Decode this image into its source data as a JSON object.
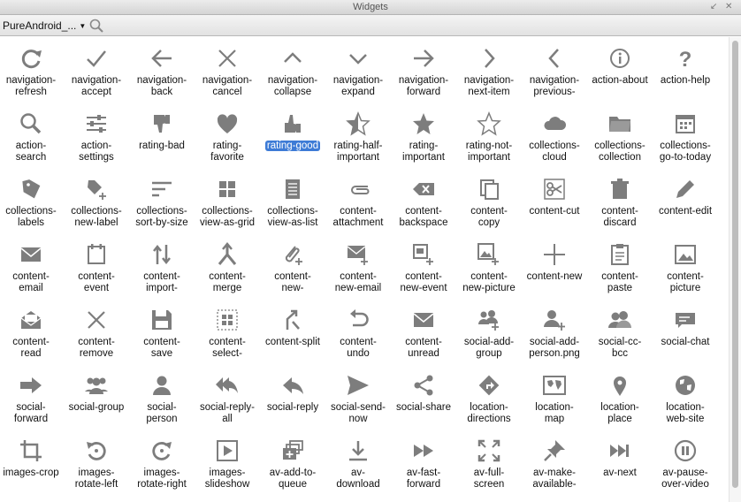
{
  "window": {
    "title": "Widgets"
  },
  "toolbar": {
    "source": "PureAndroid_..."
  },
  "colors": {
    "icon": "#7d7d7d",
    "selection": "#3d7bd6"
  },
  "selected": "rating-good",
  "icons": [
    {
      "id": "navigation-refresh",
      "label": "navigation-\nrefresh",
      "icon": "refresh"
    },
    {
      "id": "navigation-accept",
      "label": "navigation-\naccept",
      "icon": "check"
    },
    {
      "id": "navigation-back",
      "label": "navigation-\nback",
      "icon": "arrow-left"
    },
    {
      "id": "navigation-cancel",
      "label": "navigation-\ncancel",
      "icon": "x"
    },
    {
      "id": "navigation-collapse",
      "label": "navigation-\ncollapse",
      "icon": "chevron-up"
    },
    {
      "id": "navigation-expand",
      "label": "navigation-\nexpand",
      "icon": "chevron-down"
    },
    {
      "id": "navigation-forward",
      "label": "navigation-\nforward",
      "icon": "arrow-right"
    },
    {
      "id": "navigation-next-item",
      "label": "navigation-\nnext-item",
      "icon": "chevron-right"
    },
    {
      "id": "navigation-previous",
      "label": "navigation-\nprevious-",
      "icon": "chevron-left"
    },
    {
      "id": "action-about",
      "label": "action-about",
      "icon": "info"
    },
    {
      "id": "action-help",
      "label": "action-help",
      "icon": "question"
    },
    {
      "id": "action-search",
      "label": "action-\nsearch",
      "icon": "search"
    },
    {
      "id": "action-settings",
      "label": "action-\nsettings",
      "icon": "sliders"
    },
    {
      "id": "rating-bad",
      "label": "rating-bad",
      "icon": "thumbs-down"
    },
    {
      "id": "rating-favorite",
      "label": "rating-\nfavorite",
      "icon": "heart"
    },
    {
      "id": "rating-good",
      "label": "rating-good",
      "icon": "thumbs-up"
    },
    {
      "id": "rating-half-important",
      "label": "rating-half-\nimportant",
      "icon": "star-half"
    },
    {
      "id": "rating-important",
      "label": "rating-\nimportant",
      "icon": "star"
    },
    {
      "id": "rating-not-important",
      "label": "rating-not-\nimportant",
      "icon": "star-outline"
    },
    {
      "id": "collections-cloud",
      "label": "collections-\ncloud",
      "icon": "cloud"
    },
    {
      "id": "collections-collection",
      "label": "collections-\ncollection",
      "icon": "folder"
    },
    {
      "id": "collections-go-to-today",
      "label": "collections-\ngo-to-today",
      "icon": "calendar"
    },
    {
      "id": "collections-labels",
      "label": "collections-\nlabels",
      "icon": "label"
    },
    {
      "id": "collections-new-label",
      "label": "collections-\nnew-label",
      "icon": "label-plus"
    },
    {
      "id": "collections-sort-by-size",
      "label": "collections-\nsort-by-size",
      "icon": "sort"
    },
    {
      "id": "collections-view-as-grid",
      "label": "collections-\nview-as-grid",
      "icon": "grid"
    },
    {
      "id": "collections-view-as-list",
      "label": "collections-\nview-as-list",
      "icon": "list"
    },
    {
      "id": "content-attachment",
      "label": "content-\nattachment",
      "icon": "paperclip"
    },
    {
      "id": "content-backspace",
      "label": "content-\nbackspace",
      "icon": "backspace"
    },
    {
      "id": "content-copy",
      "label": "content-\ncopy",
      "icon": "copy"
    },
    {
      "id": "content-cut",
      "label": "content-cut",
      "icon": "scissors"
    },
    {
      "id": "content-discard",
      "label": "content-\ndiscard",
      "icon": "trash"
    },
    {
      "id": "content-edit",
      "label": "content-edit",
      "icon": "pencil"
    },
    {
      "id": "content-email",
      "label": "content-\nemail",
      "icon": "envelope"
    },
    {
      "id": "content-event",
      "label": "content-\nevent",
      "icon": "event"
    },
    {
      "id": "content-import",
      "label": "content-\nimport-",
      "icon": "import"
    },
    {
      "id": "content-merge",
      "label": "content-\nmerge",
      "icon": "merge"
    },
    {
      "id": "content-new",
      "label": "content-\nnew-",
      "icon": "paperclip-plus"
    },
    {
      "id": "content-new-email",
      "label": "content-\nnew-email",
      "icon": "envelope-plus"
    },
    {
      "id": "content-new-event",
      "label": "content-\nnew-event",
      "icon": "event-plus"
    },
    {
      "id": "content-new-picture",
      "label": "content-\nnew-picture",
      "icon": "picture-plus"
    },
    {
      "id": "content-new-plain",
      "label": "content-new",
      "icon": "plus"
    },
    {
      "id": "content-paste",
      "label": "content-\npaste",
      "icon": "clipboard"
    },
    {
      "id": "content-picture",
      "label": "content-\npicture",
      "icon": "picture"
    },
    {
      "id": "content-read",
      "label": "content-\nread",
      "icon": "envelope-open"
    },
    {
      "id": "content-remove",
      "label": "content-\nremove",
      "icon": "x"
    },
    {
      "id": "content-save",
      "label": "content-\nsave",
      "icon": "save"
    },
    {
      "id": "content-select",
      "label": "content-\nselect-",
      "icon": "select"
    },
    {
      "id": "content-split",
      "label": "content-split",
      "icon": "split"
    },
    {
      "id": "content-undo",
      "label": "content-\nundo",
      "icon": "undo"
    },
    {
      "id": "content-unread",
      "label": "content-\nunread",
      "icon": "envelope"
    },
    {
      "id": "social-add-group",
      "label": "social-add-\ngroup",
      "icon": "group-plus"
    },
    {
      "id": "social-add-person",
      "label": "social-add-\nperson.png",
      "icon": "person-plus"
    },
    {
      "id": "social-cc-bcc",
      "label": "social-cc-\nbcc",
      "icon": "two-persons"
    },
    {
      "id": "social-chat",
      "label": "social-chat",
      "icon": "chat"
    },
    {
      "id": "social-forward",
      "label": "social-\nforward",
      "icon": "forward-arrow"
    },
    {
      "id": "social-group",
      "label": "social-group",
      "icon": "group"
    },
    {
      "id": "social-person",
      "label": "social-\nperson",
      "icon": "person"
    },
    {
      "id": "social-reply-all",
      "label": "social-reply-\nall",
      "icon": "reply-all"
    },
    {
      "id": "social-reply",
      "label": "social-reply",
      "icon": "reply"
    },
    {
      "id": "social-send-now",
      "label": "social-send-\nnow",
      "icon": "send"
    },
    {
      "id": "social-share",
      "label": "social-share",
      "icon": "share"
    },
    {
      "id": "location-directions",
      "label": "location-\ndirections",
      "icon": "directions"
    },
    {
      "id": "location-map",
      "label": "location-\nmap",
      "icon": "map"
    },
    {
      "id": "location-place",
      "label": "location-\nplace",
      "icon": "pin"
    },
    {
      "id": "location-web-site",
      "label": "location-\nweb-site",
      "icon": "globe"
    },
    {
      "id": "images-crop",
      "label": "images-crop",
      "icon": "crop"
    },
    {
      "id": "images-rotate-left",
      "label": "images-\nrotate-left",
      "icon": "rotate-left"
    },
    {
      "id": "images-rotate-right",
      "label": "images-\nrotate-right",
      "icon": "rotate-right"
    },
    {
      "id": "images-slideshow",
      "label": "images-\nslideshow",
      "icon": "slideshow"
    },
    {
      "id": "av-add-to-queue",
      "label": "av-add-to-\nqueue",
      "icon": "queue"
    },
    {
      "id": "av-download",
      "label": "av-\ndownload",
      "icon": "download"
    },
    {
      "id": "av-fast-forward",
      "label": "av-fast-\nforward",
      "icon": "fast-forward"
    },
    {
      "id": "av-full-screen",
      "label": "av-full-\nscreen",
      "icon": "fullscreen"
    },
    {
      "id": "av-make-available",
      "label": "av-make-\navailable-",
      "icon": "pushpin"
    },
    {
      "id": "av-next",
      "label": "av-next",
      "icon": "next"
    },
    {
      "id": "av-pause-over-video",
      "label": "av-pause-\nover-video",
      "icon": "pause-circle"
    }
  ]
}
